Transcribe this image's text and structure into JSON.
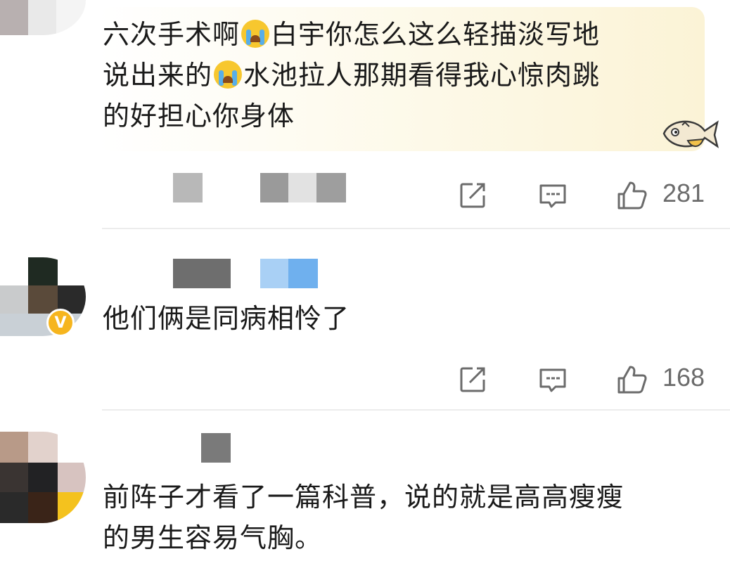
{
  "comments": [
    {
      "text_line1_a": "六次手术啊",
      "text_line1_b": "白宇你怎么这么轻描淡写地",
      "text_line2_a": "说出来的",
      "text_line2_b": "水池拉人那期看得我心惊肉跳",
      "text_line3": "的好担心你身体",
      "emoji": "crying-face-icon",
      "decoration": "fish-sticker-icon",
      "likes": "281"
    },
    {
      "text": "他们俩是同病相怜了",
      "badge": "V",
      "likes": "168"
    },
    {
      "text_line1": "前阵子才看了一篇科普，说的就是高高瘦瘦",
      "text_line2": "的男生容易气胸。"
    }
  ],
  "icons": {
    "share": "share-icon",
    "reply": "comment-icon",
    "like": "thumbs-up-icon"
  },
  "colors": {
    "badge": "#f6b51e",
    "bubble": "#fbf3d6",
    "action_gray": "#6b6b6b"
  }
}
